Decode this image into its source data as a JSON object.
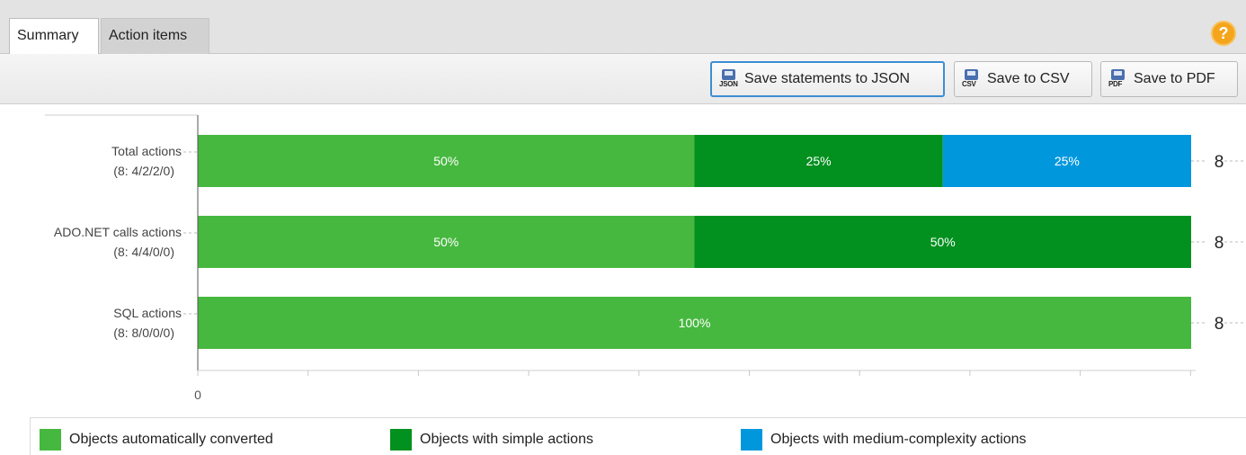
{
  "tabs": [
    {
      "label": "Summary",
      "active": true
    },
    {
      "label": "Action items",
      "active": false
    }
  ],
  "help_icon": "help-icon",
  "toolbar": {
    "save_json": {
      "label": "Save statements to JSON",
      "icon_tag": "JSON"
    },
    "save_csv": {
      "label": "Save to CSV",
      "icon_tag": "CSV"
    },
    "save_pdf": {
      "label": "Save to PDF",
      "icon_tag": "PDF"
    }
  },
  "colors": {
    "auto": "#46b83f",
    "simple": "#02901f",
    "medium": "#0097dd"
  },
  "chart_data": {
    "type": "bar",
    "orientation": "horizontal",
    "stacked": true,
    "categories": [
      [
        "Total actions",
        "(8: 4/2/2/0)"
      ],
      [
        "ADO.NET calls actions",
        "(8: 4/4/0/0)"
      ],
      [
        "SQL actions",
        "(8: 8/0/0/0)"
      ]
    ],
    "series": [
      {
        "name": "Objects automatically converted",
        "values": [
          50,
          50,
          100
        ],
        "labels": [
          "50%",
          "50%",
          "100%"
        ]
      },
      {
        "name": "Objects with simple actions",
        "values": [
          25,
          50,
          0
        ],
        "labels": [
          "25%",
          "50%",
          ""
        ]
      },
      {
        "name": "Objects with medium-complexity actions",
        "values": [
          25,
          0,
          0
        ],
        "labels": [
          "25%",
          "",
          ""
        ]
      }
    ],
    "totals": [
      "8",
      "8",
      "8"
    ],
    "x_tick_label": "0",
    "xlim": [
      0,
      100
    ],
    "legend": "bottom"
  }
}
